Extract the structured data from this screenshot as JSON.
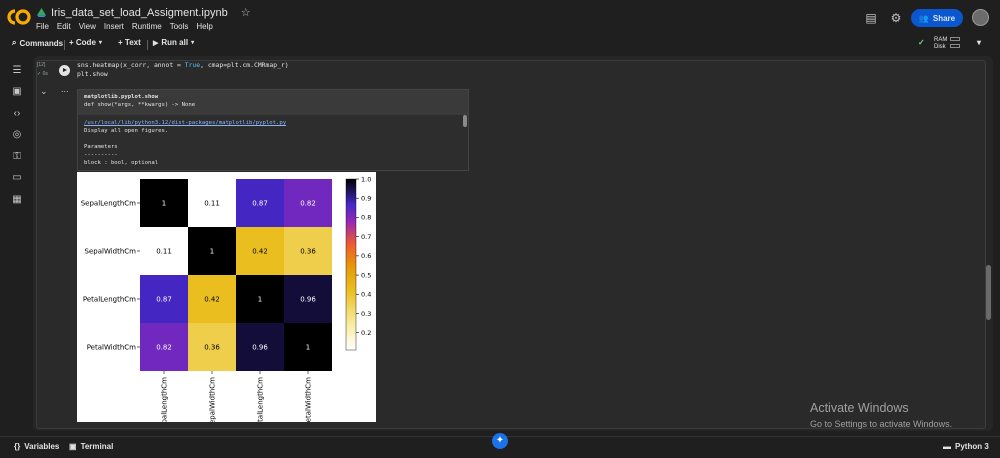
{
  "header": {
    "notebook_title": "Iris_data_set_load_Assigment.ipynb",
    "menu": [
      "File",
      "Edit",
      "View",
      "Insert",
      "Runtime",
      "Tools",
      "Help"
    ],
    "share_label": "Share"
  },
  "toolbar": {
    "commands_label": "Commands",
    "code_label": "+ Code",
    "text_label": "+ Text",
    "run_all_label": "Run all",
    "ram_label": "RAM",
    "disk_label": "Disk"
  },
  "cell": {
    "exec_count": "[12]",
    "status": "0s",
    "code_line1_a": "sns.heatmap(x_corr, annot = ",
    "code_line1_kw": "True",
    "code_line1_b": ", cmap=plt.cm.CMRmap_r)",
    "code_line2": "plt.show",
    "output_menu": "..."
  },
  "doc": {
    "signature_line1": "matplotlib.pyplot.show",
    "signature_line2": "def show(*args, **kwargs) -> None",
    "path": "/usr/local/lib/python3.12/dist-packages/matplotlib/pyplot.py",
    "desc": "Display all open figures.",
    "params_title": "Parameters",
    "params_rule": "----------",
    "param1": "block : bool, optional"
  },
  "chart_data": {
    "type": "heatmap",
    "rows": [
      "SepalLengthCm",
      "SepalWidthCm",
      "PetalLengthCm",
      "PetalWidthCm"
    ],
    "cols": [
      "SepalLengthCm",
      "SepalWidthCm",
      "PetalLengthCm",
      "PetalWidthCm"
    ],
    "values": [
      [
        1,
        0.11,
        0.87,
        0.82
      ],
      [
        0.11,
        1,
        0.42,
        0.36
      ],
      [
        0.87,
        0.42,
        1,
        0.96
      ],
      [
        0.82,
        0.36,
        0.96,
        1
      ]
    ],
    "annotations": [
      [
        "1",
        "0.11",
        "0.87",
        "0.82"
      ],
      [
        "0.11",
        "1",
        "0.42",
        "0.36"
      ],
      [
        "0.87",
        "0.42",
        "1",
        "0.96"
      ],
      [
        "0.82",
        "0.36",
        "0.96",
        "1"
      ]
    ],
    "colormap": "CMRmap_r",
    "colorbar_range": [
      0.11,
      1.0
    ],
    "colorbar_ticks": [
      "1.0",
      "0.9",
      "0.8",
      "0.7",
      "0.6",
      "0.5",
      "0.4",
      "0.3",
      "0.2"
    ]
  },
  "watermark": {
    "title": "Activate Windows",
    "subtitle": "Go to Settings to activate Windows."
  },
  "footer": {
    "variables_label": "Variables",
    "terminal_label": "Terminal",
    "runtime_label": "Python 3"
  },
  "colors": {
    "accent": "#0b57d0",
    "background": "#1f1f1f"
  }
}
